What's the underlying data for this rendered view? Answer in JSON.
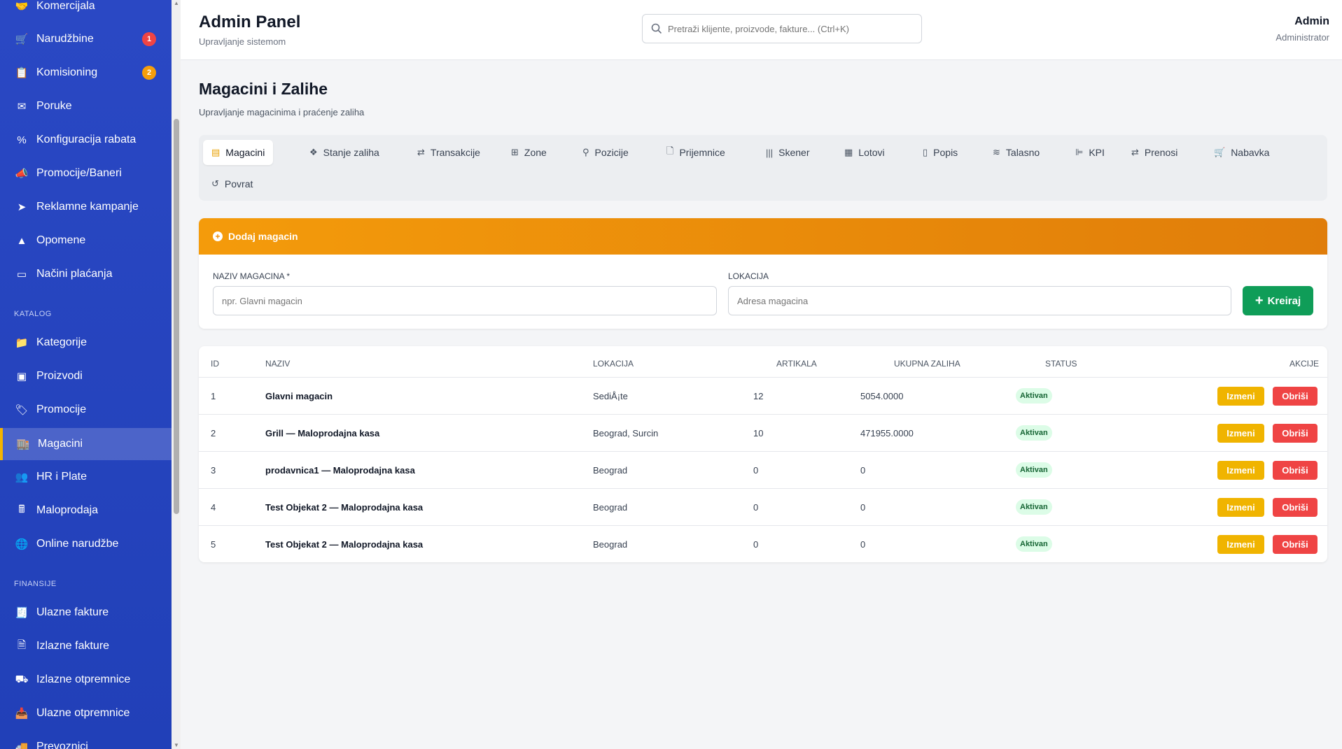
{
  "sidebar": {
    "items_top": [
      {
        "label": "Komercijala",
        "icon": "handshake-icon"
      },
      {
        "label": "Narudžbine",
        "icon": "cart-icon",
        "badge": "1",
        "badge_color": "#ef4444"
      },
      {
        "label": "Komisioning",
        "icon": "clipboard-icon",
        "badge": "2",
        "badge_color": "#f59e0b"
      },
      {
        "label": "Poruke",
        "icon": "envelope-icon"
      },
      {
        "label": "Konfiguracija rabata",
        "icon": "percent-icon"
      },
      {
        "label": "Promocije/Baneri",
        "icon": "megaphone-icon"
      },
      {
        "label": "Reklamne kampanje",
        "icon": "paper-plane-icon"
      },
      {
        "label": "Opomene",
        "icon": "warning-icon"
      },
      {
        "label": "Načini plaćanja",
        "icon": "credit-card-icon"
      }
    ],
    "section_katalog": "KATALOG",
    "items_katalog": [
      {
        "label": "Kategorije",
        "icon": "folder-icon"
      },
      {
        "label": "Proizvodi",
        "icon": "box-icon"
      },
      {
        "label": "Promocije",
        "icon": "tag-icon"
      },
      {
        "label": "Magacini",
        "icon": "warehouse-icon",
        "active": true
      },
      {
        "label": "HR i Plate",
        "icon": "users-icon"
      },
      {
        "label": "Maloprodaja",
        "icon": "cash-register-icon"
      },
      {
        "label": "Online narudžbe",
        "icon": "globe-icon"
      }
    ],
    "section_finansije": "FINANSIJE",
    "items_finansije": [
      {
        "label": "Ulazne fakture",
        "icon": "invoice-icon"
      },
      {
        "label": "Izlazne fakture",
        "icon": "invoice-out-icon"
      },
      {
        "label": "Izlazne otpremnice",
        "icon": "dolly-icon"
      },
      {
        "label": "Ulazne otpremnice",
        "icon": "inbox-icon"
      },
      {
        "label": "Prevoznici",
        "icon": "truck-icon"
      }
    ]
  },
  "header": {
    "title": "Admin Panel",
    "subtitle": "Upravljanje sistemom",
    "search_placeholder": "Pretraži klijente, proizvode, fakture... (Ctrl+K)",
    "user_name": "Admin",
    "user_role": "Administrator"
  },
  "page": {
    "title": "Magacini i Zalihe",
    "subtitle": "Upravljanje magacinima i praćenje zaliha"
  },
  "tabs": [
    {
      "label": "Magacini",
      "icon": "warehouse-icon",
      "active": true
    },
    {
      "label": "Stanje zaliha",
      "icon": "cubes-icon"
    },
    {
      "label": "Transakcije",
      "icon": "exchange-icon"
    },
    {
      "label": "Zone",
      "icon": "grid-icon"
    },
    {
      "label": "Pozicije",
      "icon": "map-pin-icon"
    },
    {
      "label": "Prijemnice",
      "icon": "file-import-icon"
    },
    {
      "label": "Skener",
      "icon": "barcode-icon"
    },
    {
      "label": "Lotovi",
      "icon": "boxes-icon"
    },
    {
      "label": "Popis",
      "icon": "clipboard-icon"
    },
    {
      "label": "Talasno",
      "icon": "layers-icon"
    },
    {
      "label": "KPI",
      "icon": "chart-icon"
    },
    {
      "label": "Prenosi",
      "icon": "exchange-icon"
    },
    {
      "label": "Nabavka",
      "icon": "cart-icon"
    },
    {
      "label": "Povrat",
      "icon": "undo-icon"
    }
  ],
  "add_form": {
    "header_label": "Dodaj magacin",
    "name_label": "NAZIV MAGACINA *",
    "name_placeholder": "npr. Glavni magacin",
    "location_label": "LOKACIJA",
    "location_placeholder": "Adresa magacina",
    "create_label": "Kreiraj"
  },
  "table": {
    "columns": [
      "ID",
      "NAZIV",
      "LOKACIJA",
      "ARTIKALA",
      "UKUPNA ZALIHA",
      "STATUS",
      "AKCIJE"
    ],
    "edit_label": "Izmeni",
    "delete_label": "Obriši",
    "rows": [
      {
        "id": "1",
        "name": "Glavni magacin",
        "location": "SediÅ¡te",
        "items": "12",
        "stock": "5054.0000",
        "status": "Aktivan"
      },
      {
        "id": "2",
        "name": "Grill — Maloprodajna kasa",
        "location": "Beograd, Surcin",
        "items": "10",
        "stock": "471955.0000",
        "status": "Aktivan"
      },
      {
        "id": "3",
        "name": "prodavnica1 — Maloprodajna kasa",
        "location": "Beograd",
        "items": "0",
        "stock": "0",
        "status": "Aktivan"
      },
      {
        "id": "4",
        "name": "Test Objekat 2 — Maloprodajna kasa",
        "location": "Beograd",
        "items": "0",
        "stock": "0",
        "status": "Aktivan"
      },
      {
        "id": "5",
        "name": "Test Objekat 2 — Maloprodajna kasa",
        "location": "Beograd",
        "items": "0",
        "stock": "0",
        "status": "Aktivan"
      }
    ]
  }
}
